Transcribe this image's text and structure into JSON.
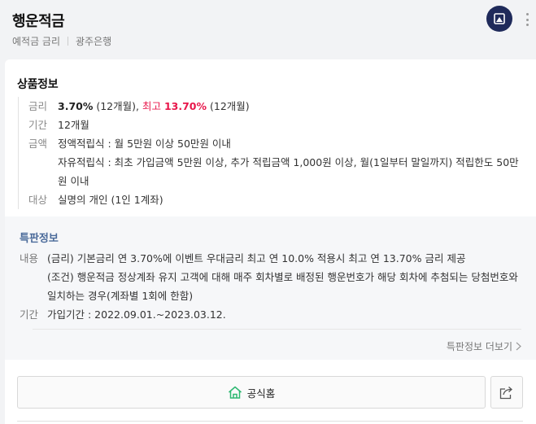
{
  "header": {
    "title": "행운적금",
    "category": "예적금 금리",
    "bank": "광주은행",
    "logo_icon": "bank-logo-icon",
    "more_icon": "more-vertical-icon"
  },
  "product_info": {
    "title": "상품정보",
    "rate": {
      "label": "금리",
      "base_rate": "3.70%",
      "base_term": " (12개월), ",
      "max_prefix": "최고 ",
      "max_rate": "13.70%",
      "max_term": " (12개월)"
    },
    "term": {
      "label": "기간",
      "value": "12개월"
    },
    "amount": {
      "label": "금액",
      "line1": "정액적립식 : 월 5만원 이상 50만원 이내",
      "line2": "자유적립식 : 최초 가입금액 5만원 이상, 추가 적립금액 1,000원 이상, 월(1일부터 말일까지) 적립한도 50만원 이내"
    },
    "target": {
      "label": "대상",
      "value": "실명의 개인 (1인 1계좌)"
    }
  },
  "special_info": {
    "title": "특판정보",
    "content": {
      "label": "내용",
      "line1": "(금리) 기본금리 연 3.70%에 이벤트 우대금리 최고 연 10.0% 적용시 최고 연 13.70% 금리 제공",
      "line2": "(조건) 행운적금 정상계좌 유지 고객에 대해 매주 회차별로 배정된 행운번호가 해당 회차에 추첨되는 당첨번호와 일치하는 경우(계좌별 1회에 한함)"
    },
    "period": {
      "label": "기간",
      "value": "가입기간 : 2022.09.01.~2023.03.12."
    },
    "more_label": "특판정보 더보기"
  },
  "actions": {
    "homepage_label": "공식홈",
    "share_icon": "share-icon"
  },
  "colors": {
    "accent_red": "#e8174b",
    "special_title": "#4a6a9a",
    "logo_bg": "#1f2a5a",
    "home_icon": "#2eb872"
  }
}
